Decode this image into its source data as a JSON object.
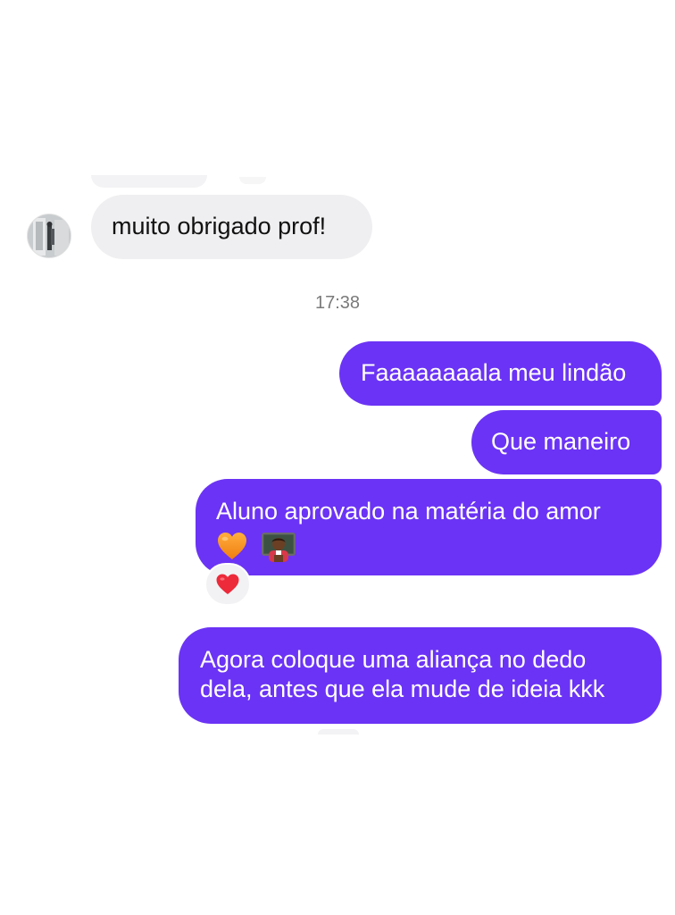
{
  "conversation": {
    "incoming": [
      {
        "text": "muito obrigado prof!"
      }
    ],
    "timestamp": "17:38",
    "outgoing": [
      {
        "text": "Faaaaaaaala meu lindão"
      },
      {
        "text": "Que maneiro"
      },
      {
        "text": "Aluno aprovado na matéria do amor",
        "emojis": [
          "orange-heart",
          "teacher-emoji"
        ]
      },
      {
        "lines": [
          "Agora coloque uma aliança no dedo",
          "dela, antes que ela mude de ideia kkk"
        ]
      }
    ],
    "reaction": {
      "emoji": "red-heart"
    }
  },
  "colors": {
    "outgoing_bubble": "#6b33f5",
    "incoming_bubble": "#efeff1",
    "timestamp_text": "#7a7a7a"
  }
}
